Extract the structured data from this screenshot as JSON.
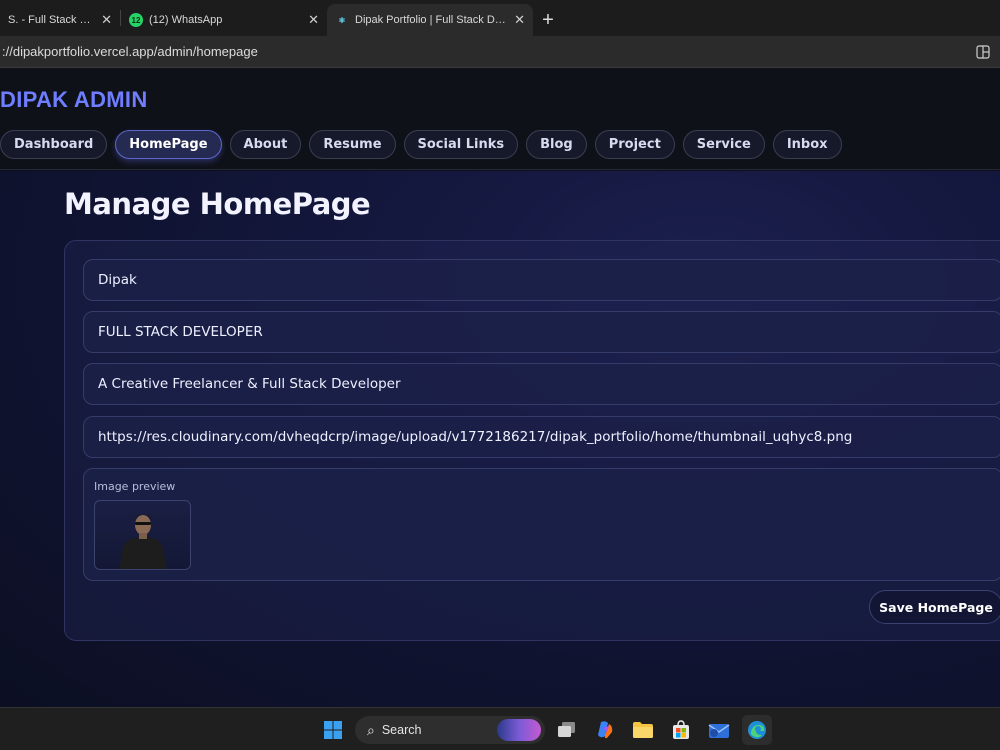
{
  "browser": {
    "tabs": [
      {
        "title": "S. - Full Stack Web De",
        "close": "✕",
        "favicon": "",
        "state": "inactive"
      },
      {
        "title": "(12) WhatsApp",
        "close": "✕",
        "favicon": "12",
        "state": "inactive"
      },
      {
        "title": "Dipak Portfolio | Full Stack Develop",
        "close": "✕",
        "favicon": "react-icon",
        "state": "active"
      }
    ],
    "new_tab": "+",
    "url": "://dipakportfolio.vercel.app/admin/homepage"
  },
  "header": {
    "brand": "DIPAK ADMIN",
    "brand_color": "#6f7dff",
    "nav": [
      {
        "label": "Dashboard",
        "active": false
      },
      {
        "label": "HomePage",
        "active": true
      },
      {
        "label": "About",
        "active": false
      },
      {
        "label": "Resume",
        "active": false
      },
      {
        "label": "Social Links",
        "active": false
      },
      {
        "label": "Blog",
        "active": false
      },
      {
        "label": "Project",
        "active": false
      },
      {
        "label": "Service",
        "active": false
      },
      {
        "label": "Inbox",
        "active": false
      }
    ]
  },
  "main": {
    "title": "Manage HomePage",
    "fields": {
      "name": "Dipak",
      "role": "FULL STACK DEVELOPER",
      "tagline": "A Creative Freelancer & Full Stack Developer",
      "image_url": "https://res.cloudinary.com/dvheqdcrp/image/upload/v1772186217/dipak_portfolio/home/thumbnail_uqhyc8.png"
    },
    "preview_label": "Image preview",
    "save_label": "Save HomePage"
  },
  "taskbar": {
    "search_label": "Search",
    "icons": [
      "windows-start-icon",
      "search-icon",
      "task-view-icon",
      "copilot-icon",
      "file-explorer-icon",
      "store-icon",
      "mail-icon",
      "edge-icon"
    ]
  }
}
